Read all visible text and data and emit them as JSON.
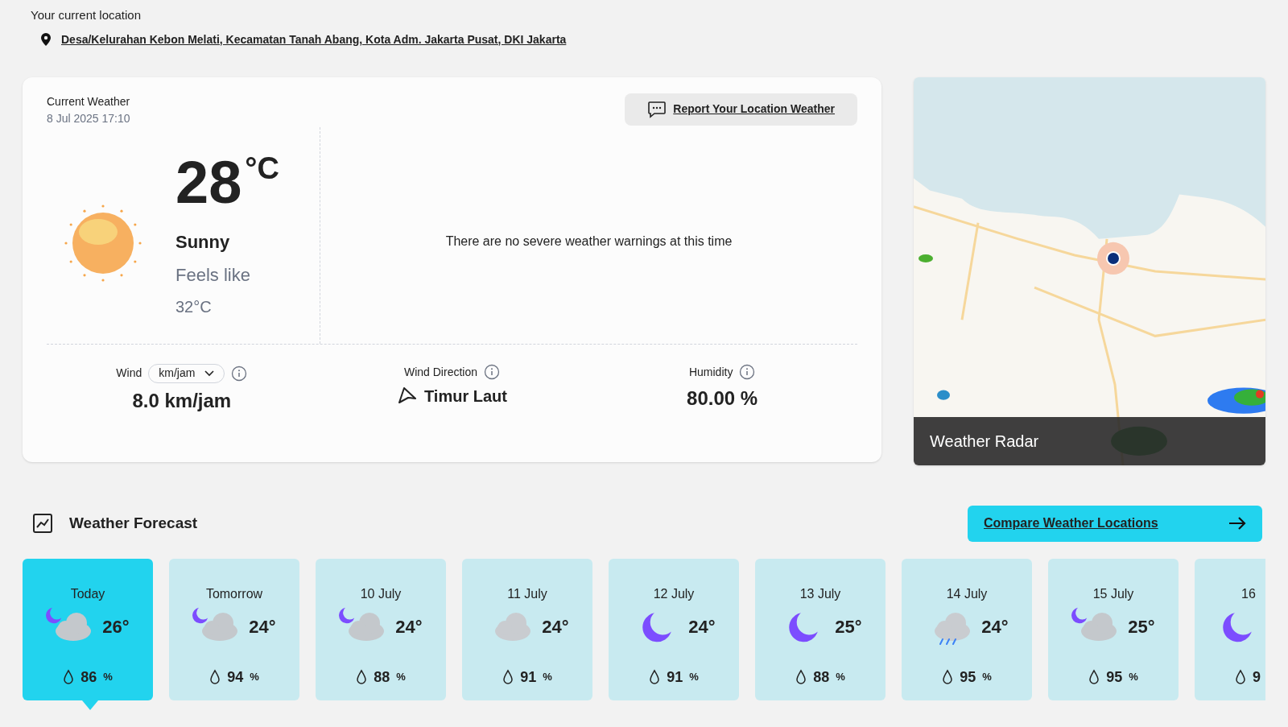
{
  "location": {
    "label": "Your current location",
    "address": "Desa/Kelurahan Kebon Melati, Kecamatan Tanah Abang, Kota Adm. Jakarta Pusat, DKI Jakarta"
  },
  "current": {
    "title": "Current Weather",
    "timestamp": "8 Jul 2025 17:10",
    "report_button": "Report Your Location Weather",
    "temperature": "28",
    "unit": "°C",
    "condition": "Sunny",
    "feels_like_label": "Feels like",
    "feels_like": "32°C",
    "warning": "There are no severe weather warnings at this time",
    "stats": [
      {
        "label": "Wind",
        "unit_select": "km/jam",
        "value": "8.0 km/jam"
      },
      {
        "label": "Wind Direction",
        "value": "Timur Laut"
      },
      {
        "label": "Humidity",
        "value": "80.00 %"
      }
    ]
  },
  "radar": {
    "kind": "picture",
    "caption": "Weather Radar"
  },
  "forecast": {
    "title": "Weather Forecast",
    "compare_button": "Compare Weather Locations",
    "days": [
      {
        "label": "Today",
        "kind": "partly-cloudy-night",
        "temp": "26°",
        "humidity": "86",
        "unit": "%",
        "selected": true
      },
      {
        "label": "Tomorrow",
        "kind": "partly-cloudy-night",
        "temp": "24°",
        "humidity": "94",
        "unit": "%",
        "selected": false
      },
      {
        "label": "10 July",
        "kind": "partly-cloudy-night",
        "temp": "24°",
        "humidity": "88",
        "unit": "%",
        "selected": false
      },
      {
        "label": "11 July",
        "kind": "cloudy",
        "temp": "24°",
        "humidity": "91",
        "unit": "%",
        "selected": false
      },
      {
        "label": "12 July",
        "kind": "night",
        "temp": "24°",
        "humidity": "91",
        "unit": "%",
        "selected": false
      },
      {
        "label": "13 July",
        "kind": "night",
        "temp": "25°",
        "humidity": "88",
        "unit": "%",
        "selected": false
      },
      {
        "label": "14 July",
        "kind": "rain",
        "temp": "24°",
        "humidity": "95",
        "unit": "%",
        "selected": false
      },
      {
        "label": "15 July",
        "kind": "partly-cloudy-night",
        "temp": "25°",
        "humidity": "95",
        "unit": "%",
        "selected": false
      },
      {
        "label": "16",
        "kind": "night",
        "humidity": "9",
        "selected": false
      }
    ]
  }
}
